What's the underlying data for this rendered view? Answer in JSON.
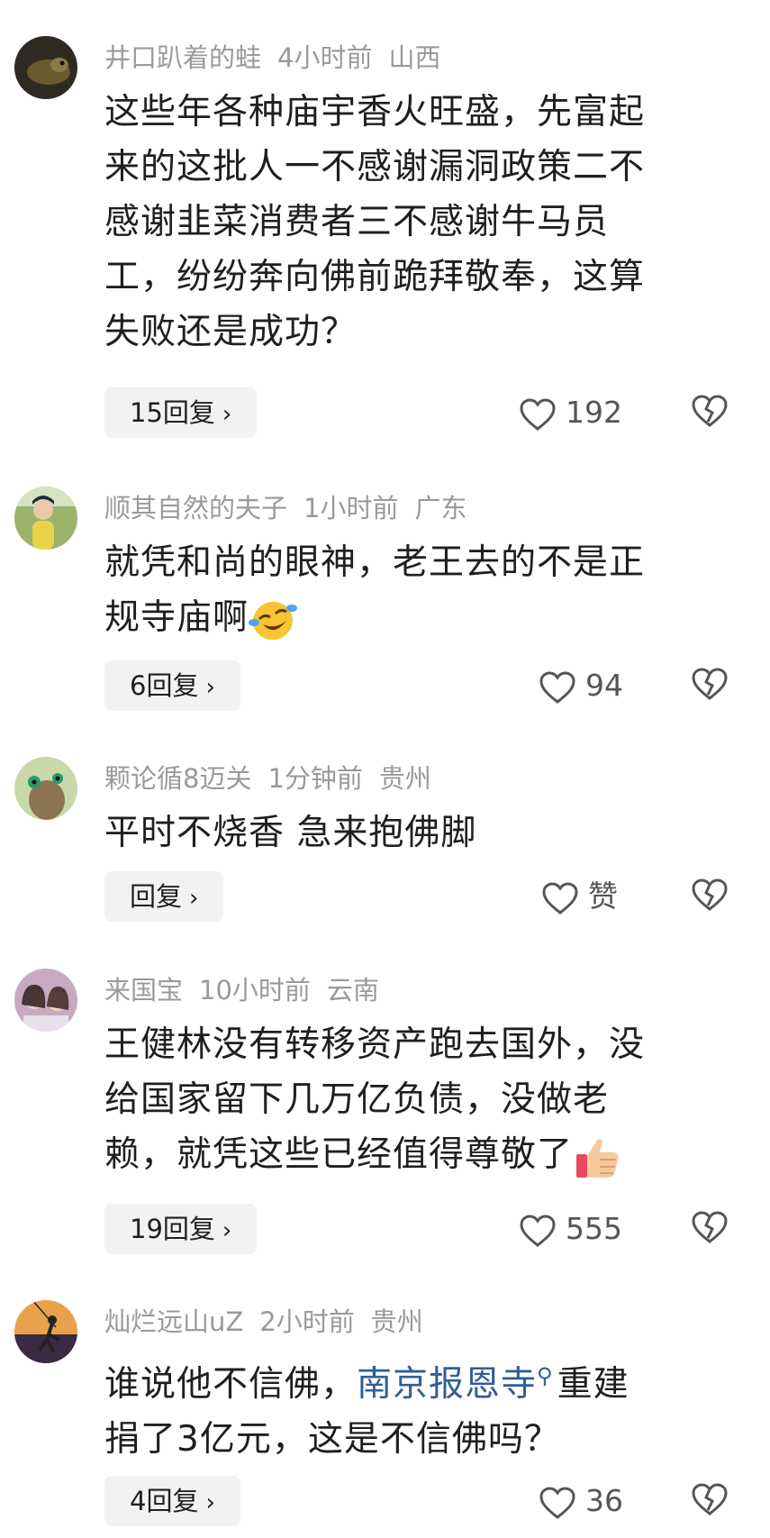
{
  "comments": [
    {
      "username": "井口趴着的蛙",
      "time": "4小时前",
      "location": "山西",
      "text_lines": [
        "这些年各种庙宇香火旺盛，先富起",
        "来的这批人一不感谢漏洞政策二不",
        "感谢韭菜消费者三不感谢牛马员",
        "工，纷纷奔向佛前跪拜敬奉，这算",
        "失败还是成功？"
      ],
      "reply_label": "15回复",
      "likes": "192",
      "avatar_icon": "frog-dark-avatar-icon"
    },
    {
      "username": "顺其自然的夫子",
      "time": "1小时前",
      "location": "广东",
      "text_lines": [
        "就凭和尚的眼神，老王去的不是正",
        "规寺庙啊"
      ],
      "emoji": "laughing-crying-emoji",
      "reply_label": "6回复",
      "likes": "94",
      "avatar_icon": "child-photo-avatar-icon"
    },
    {
      "username": "颗论循8迈关",
      "time": "1分钟前",
      "location": "贵州",
      "text_lines": [
        "平时不烧香 急来抱佛脚"
      ],
      "reply_label": "回复",
      "likes": "赞",
      "avatar_icon": "green-creature-avatar-icon"
    },
    {
      "username": "来国宝",
      "time": "10小时前",
      "location": "云南",
      "text_lines": [
        "王健林没有转移资产跑去国外，没",
        "给国家留下几万亿负债，没做老",
        "赖，就凭这些已经值得尊敬了"
      ],
      "emoji": "thumbs-up-emoji",
      "reply_label": "19回复",
      "likes": "555",
      "avatar_icon": "two-women-avatar-icon"
    },
    {
      "username": "灿烂远山uZ",
      "time": "2小时前",
      "location": "贵州",
      "text_pre": "谁说他不信佛，",
      "text_link": "南京报恩寺",
      "text_post": "重建",
      "text_line2": "捐了3亿元，这是不信佛吗？",
      "reply_label": "4回复",
      "likes": "36",
      "avatar_icon": "climber-silhouette-avatar-icon"
    }
  ],
  "icons": {
    "heart": "heart-outline-icon",
    "dislike": "broken-heart-icon",
    "chevron": "chevron-right-icon",
    "search": "search-icon"
  },
  "colors": {
    "link": "#2f5e94",
    "meta": "#9a9a9a",
    "text": "#1f1f1f",
    "reply_bg": "#f2f2f2"
  }
}
